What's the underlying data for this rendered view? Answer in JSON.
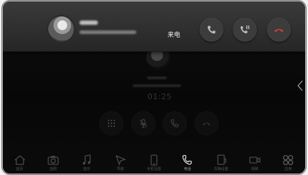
{
  "incoming_call": {
    "status_label": "来电",
    "actions": {
      "answer": "answer-icon",
      "hold": "hold-call-icon",
      "reject": "hang-up-icon"
    }
  },
  "active_call": {
    "duration": "01:25",
    "controls": [
      "keypad-icon",
      "microphone-icon",
      "handset-icon",
      "hang-up-icon"
    ]
  },
  "bottom_nav": {
    "items": [
      {
        "id": "home",
        "label": "首页",
        "icon": "home-icon"
      },
      {
        "id": "camera",
        "label": "拍照",
        "icon": "camera-icon"
      },
      {
        "id": "music",
        "label": "音乐",
        "icon": "music-note-icon"
      },
      {
        "id": "nav",
        "label": "导航",
        "icon": "navigation-icon"
      },
      {
        "id": "phone-transfer",
        "label": "手机互联",
        "icon": "phone-link-icon"
      },
      {
        "id": "phone",
        "label": "电话",
        "icon": "phone-icon"
      },
      {
        "id": "settings",
        "label": "车辆设置",
        "icon": "car-settings-icon"
      },
      {
        "id": "media",
        "label": "视频",
        "icon": "video-icon"
      },
      {
        "id": "apps",
        "label": "应用",
        "icon": "apps-icon"
      }
    ],
    "active": "phone"
  },
  "colors": {
    "banner": "#2f2f2f",
    "button": "#3c3c3c",
    "reject_icon": "#c6413b",
    "answer_icon": "#bcbcbc"
  }
}
